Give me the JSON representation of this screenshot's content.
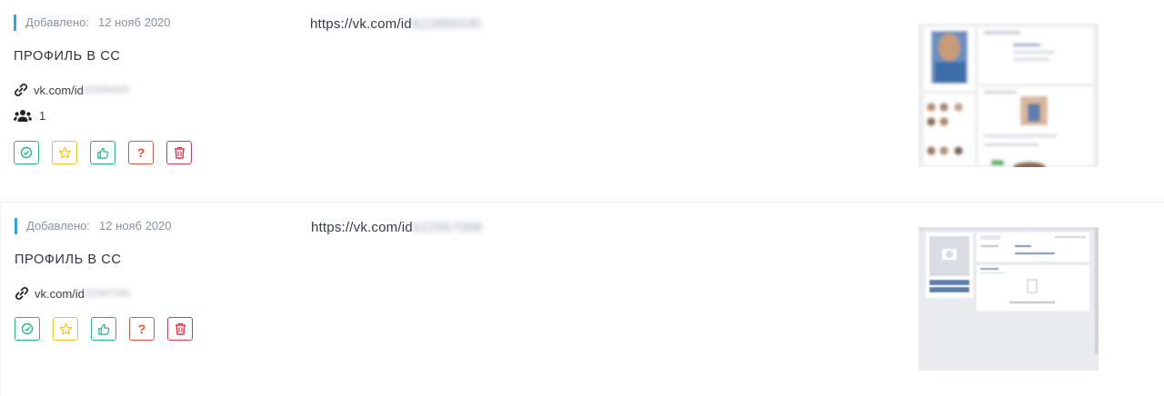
{
  "records": [
    {
      "added_label": "Добавлено:",
      "added_date": "12 нояб 2020",
      "url_prefix": "https://vk.com/id",
      "url_id": "622889330",
      "title": "ПРОФИЛЬ В СС",
      "link_prefix": "vk.com/id",
      "link_id": "622889330",
      "friends_count": "1"
    },
    {
      "added_label": "Добавлено:",
      "added_date": "12 нояб 2020",
      "url_prefix": "https://vk.com/id",
      "url_id": "622657066",
      "title": "ПРОФИЛЬ В СС",
      "link_prefix": "vk.com/id",
      "link_id": "622657066"
    }
  ],
  "actions": {
    "question_label": "?"
  },
  "icons": [
    "link-icon",
    "users-icon",
    "check-circle-icon",
    "star-icon",
    "thumbs-up-icon",
    "question-icon",
    "trash-icon"
  ],
  "colors": {
    "accent_bar": "#3aa0e6",
    "ok": "#28b487",
    "star": "#f0c020",
    "question": "#e2533a",
    "delete": "#e0344a"
  }
}
